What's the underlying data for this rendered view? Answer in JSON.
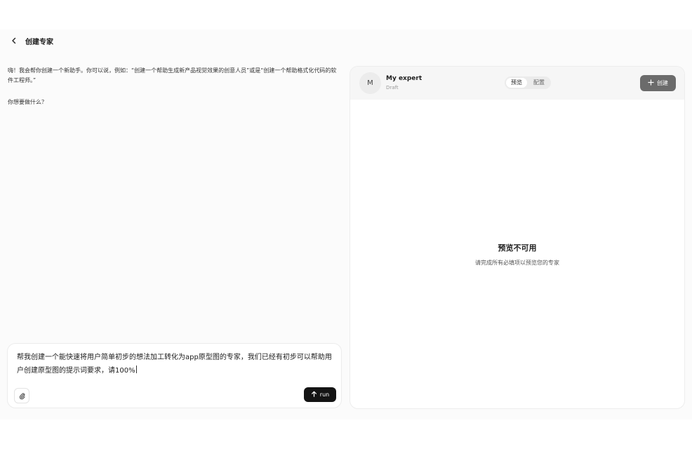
{
  "header": {
    "back_icon": "chevron-left-icon",
    "title": "创建专家"
  },
  "conversation": {
    "intro": "嗨！我会帮你创建一个新助手。你可以说，例如：“创建一个帮助生成新产品视觉效果的创意人员”或是“创建一个帮助格式化代码的软件工程师。”",
    "question": "你想要做什么？"
  },
  "composer": {
    "value": "帮我创建一个能快速将用户简单初步的想法加工转化为app原型图的专家，我们已经有初步可以帮助用户创建原型图的提示词要求，请100%",
    "attach_icon": "paperclip-icon",
    "run_label": "run",
    "run_icon": "arrow-up-icon"
  },
  "preview": {
    "avatar_letter": "M",
    "expert_name": "My expert",
    "status": "Draft",
    "tabs": [
      {
        "label": "预览",
        "active": true
      },
      {
        "label": "配置",
        "active": false
      }
    ],
    "create_label": "创建",
    "create_icon": "plus-icon",
    "unavailable_title": "预览不可用",
    "unavailable_subtitle": "请完成所有必填项以预览您的专家"
  },
  "colors": {
    "page_bg": "#fbfbfb",
    "run_button": "#141414",
    "create_button": "#6b6b6b"
  }
}
